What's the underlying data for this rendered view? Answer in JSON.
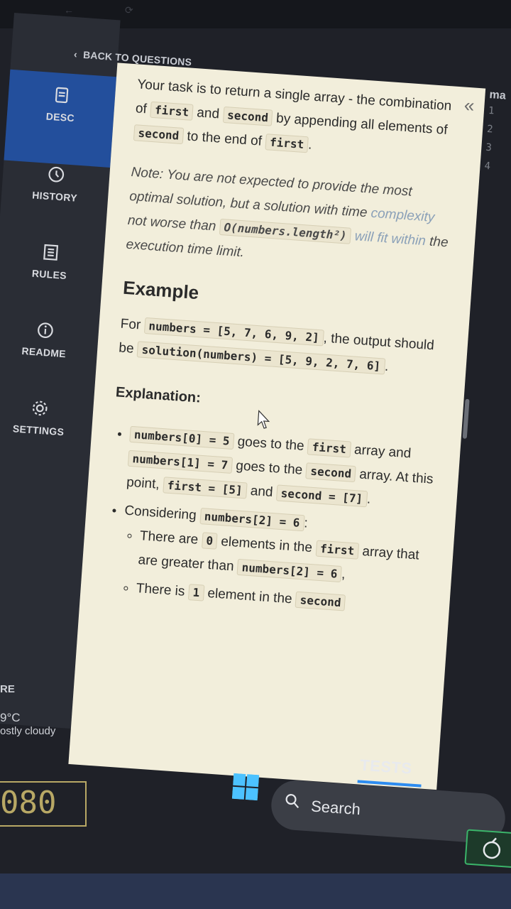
{
  "sidebar": {
    "back_label": "BACK TO QUESTIONS",
    "items": [
      {
        "label": "DESC",
        "icon": "document-icon",
        "active": true
      },
      {
        "label": "HISTORY",
        "icon": "clock-icon",
        "active": false
      },
      {
        "label": "RULES",
        "icon": "list-icon",
        "active": false
      },
      {
        "label": "README",
        "icon": "info-icon",
        "active": false
      },
      {
        "label": "SETTINGS",
        "icon": "gear-icon",
        "active": false
      }
    ]
  },
  "description": {
    "p1_part1": "Your task is to return a single array - the combination",
    "p1_of": "of",
    "p1_first": "first",
    "p1_and": "and",
    "p1_second": "second",
    "p1_part2": "by appending all elements",
    "p1_of2": "of",
    "p1_second2": "second",
    "p1_to": "to the end of",
    "p1_first2": "first",
    "p1_end": ".",
    "note_a": "Note: You are not expected to provide the most optimal solution, but a solution with time ",
    "note_b": "complexity",
    "note_c": "not worse than",
    "note_code": "O(numbers.length²)",
    "note_d": "will fit within",
    "note_e": "the execution time limit.",
    "example_heading": "Example",
    "ex_for": "For",
    "ex_code1": "numbers = [5, 7, 6, 9, 2]",
    "ex_text": ", the output should be",
    "ex_code2": "solution(numbers) = [5, 9, 2, 7, 6]",
    "ex_end": ".",
    "explanation_heading": "Explanation:",
    "b1_code1": "numbers[0] = 5",
    "b1_t1": "goes to the",
    "b1_code2": "first",
    "b1_t2": "array and",
    "b1_code3": "numbers[1] = 7",
    "b1_t3": "goes to the",
    "b1_code4": "second",
    "b1_t4": "array. At this point,",
    "b1_code5": "first = [5]",
    "b1_t5": "and",
    "b1_code6": "second = [7]",
    "b1_end": ".",
    "b2_t1": "Considering",
    "b2_code1": "numbers[2] = 6",
    "b2_end": ":",
    "s1_t1": "There are",
    "s1_code1": "0",
    "s1_t2": "elements in the",
    "s1_code2": "first",
    "s1_t3": "array that are greater than",
    "s1_code3": "numbers[2] = 6",
    "s1_end": ",",
    "s2_t1": "There is",
    "s2_code1": "1",
    "s2_t2": "element in the",
    "s2_code2": "second"
  },
  "editor": {
    "prefix": "ma",
    "lines": [
      "1",
      "2",
      "3",
      "4"
    ]
  },
  "tabs": {
    "tests": "TESTS"
  },
  "taskbar": {
    "partial_label": "RE",
    "temp": "9°C",
    "weather": "ostly cloudy",
    "search_label": "Search",
    "badge": "080"
  }
}
